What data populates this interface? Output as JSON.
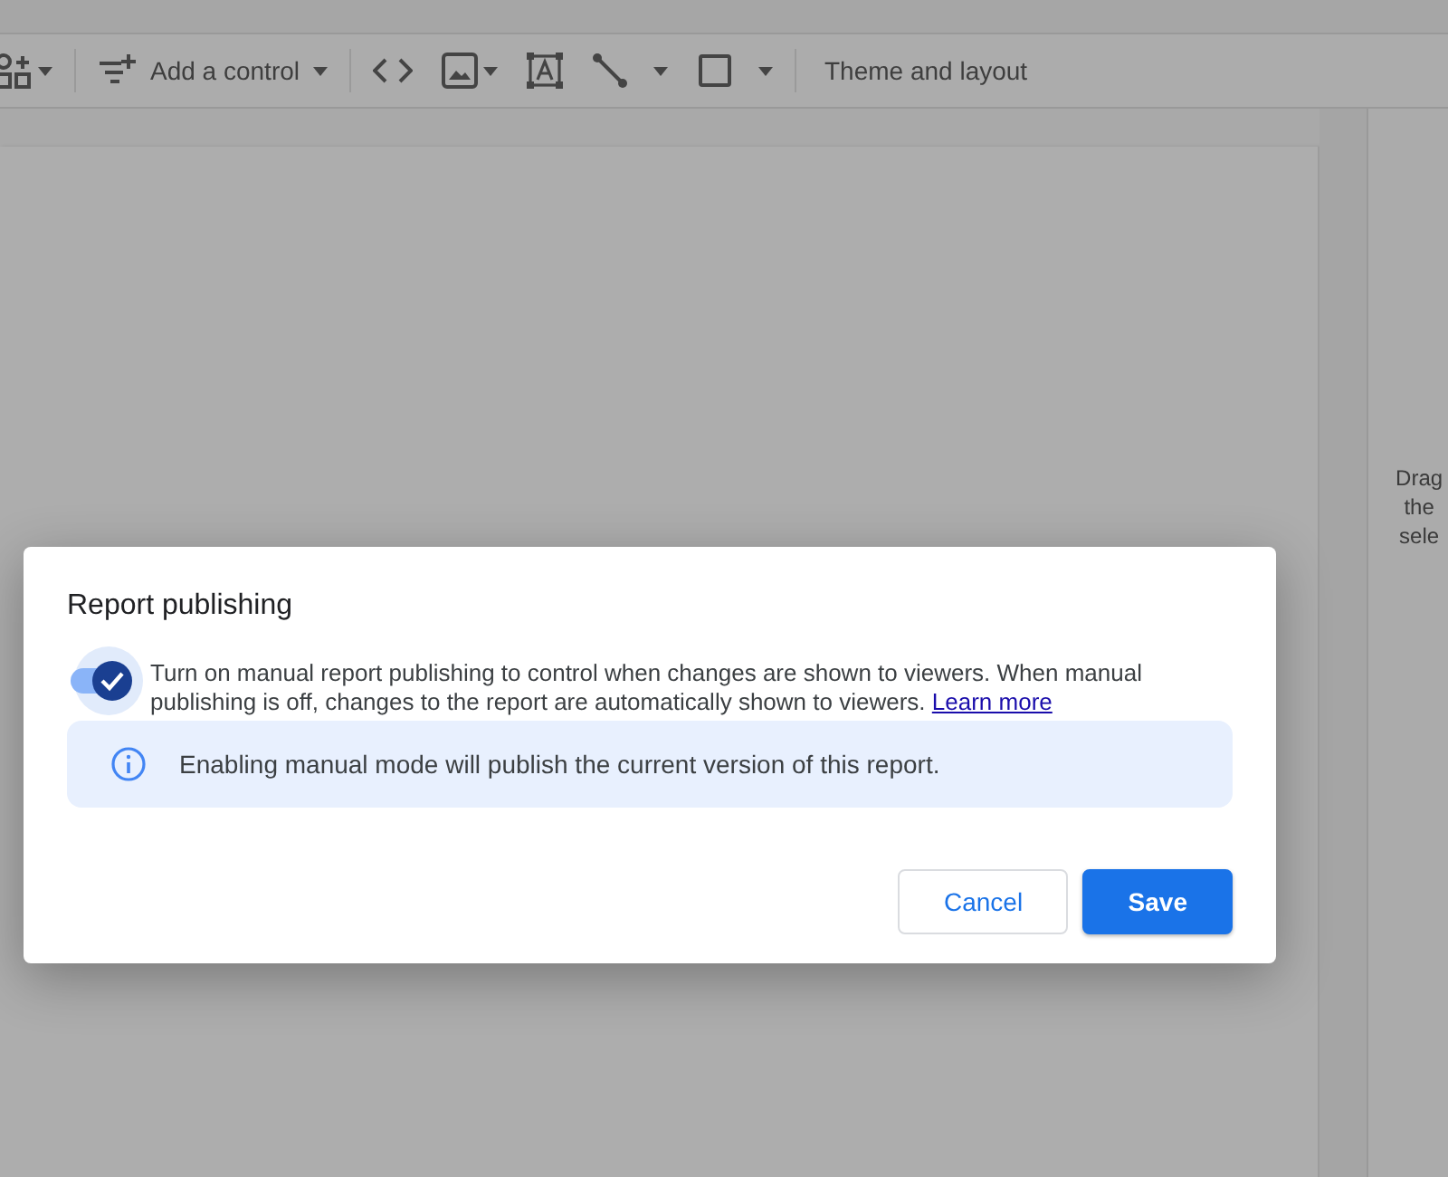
{
  "toolbar": {
    "add_control": "Add a control",
    "theme_and_layout": "Theme and layout"
  },
  "side_panel": {
    "lines": [
      "Drag",
      "the",
      "sele"
    ]
  },
  "dialog": {
    "title": "Report publishing",
    "toggle": {
      "on": true
    },
    "description": "Turn on manual report publishing to control when changes are shown to viewers. When manual publishing is off, changes to the report are automatically shown to viewers.",
    "link": "Learn more",
    "info": "Enabling manual mode will publish the current version of this report.",
    "buttons": [
      {
        "label": "Cancel",
        "kind": "secondary"
      },
      {
        "label": "Save",
        "kind": "primary"
      }
    ]
  }
}
